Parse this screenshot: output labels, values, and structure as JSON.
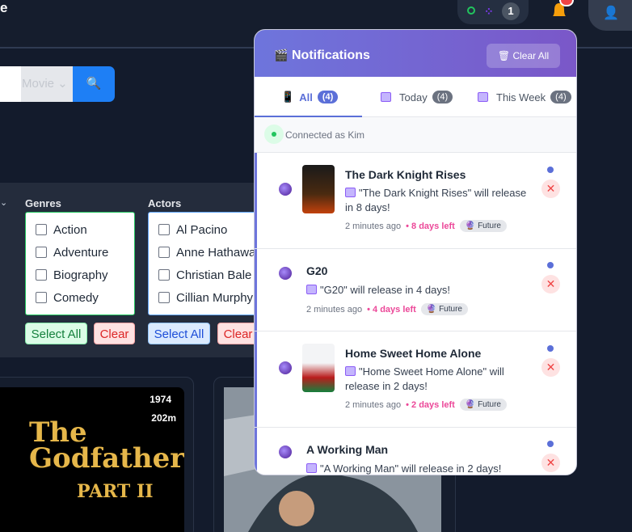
{
  "header": {
    "brand": "e",
    "connection_count": "1",
    "users_icon": "users-icon",
    "bell_icon": "bell-icon",
    "user_icon": "user-icon"
  },
  "search": {
    "type_value": "Movie",
    "button_icon": "search-icon"
  },
  "filters": {
    "genres": {
      "title": "Genres",
      "items": [
        "Action",
        "Adventure",
        "Biography",
        "Comedy"
      ],
      "select_all": "Select All",
      "clear": "Clear"
    },
    "actors": {
      "title": "Actors",
      "items": [
        "Al Pacino",
        "Anne Hathaway",
        "Christian Bale",
        "Cillian Murphy"
      ],
      "select_all": "Select All",
      "clear": "Clear"
    }
  },
  "movies": [
    {
      "year": "1974",
      "length": "202m",
      "poster_text_1": "The",
      "poster_text_2": "Godfather",
      "poster_text_3": "PART II"
    }
  ],
  "notifications": {
    "title": "Notifications",
    "clear_all": "Clear All",
    "tabs": [
      {
        "label": "All",
        "count": "(4)"
      },
      {
        "label": "Today",
        "count": "(4)"
      },
      {
        "label": "This Week",
        "count": "(4)"
      }
    ],
    "connected_text": "Connected as Kim",
    "items": [
      {
        "title": "The Dark Knight Rises",
        "message": "\"The Dark Knight Rises\" will release in 8 days!",
        "time": "2 minutes ago",
        "days_left": "• 8 days left",
        "tag": "Future"
      },
      {
        "title": "G20",
        "message": "\"G20\" will release in 4 days!",
        "time": "2 minutes ago",
        "days_left": "• 4 days left",
        "tag": "Future"
      },
      {
        "title": "Home Sweet Home Alone",
        "message": "\"Home Sweet Home Alone\" will release in 2 days!",
        "time": "2 minutes ago",
        "days_left": "• 2 days left",
        "tag": "Future"
      },
      {
        "title": "A Working Man",
        "message": "\"A Working Man\" will release in 2 days!",
        "time": "",
        "days_left": "",
        "tag": ""
      }
    ]
  },
  "colors": {
    "accent": "#5b6fd8",
    "header_gradient_start": "#6e75dc",
    "header_gradient_end": "#7a57c8",
    "pink": "#ec4899",
    "search_blue": "#1e7ff5"
  }
}
